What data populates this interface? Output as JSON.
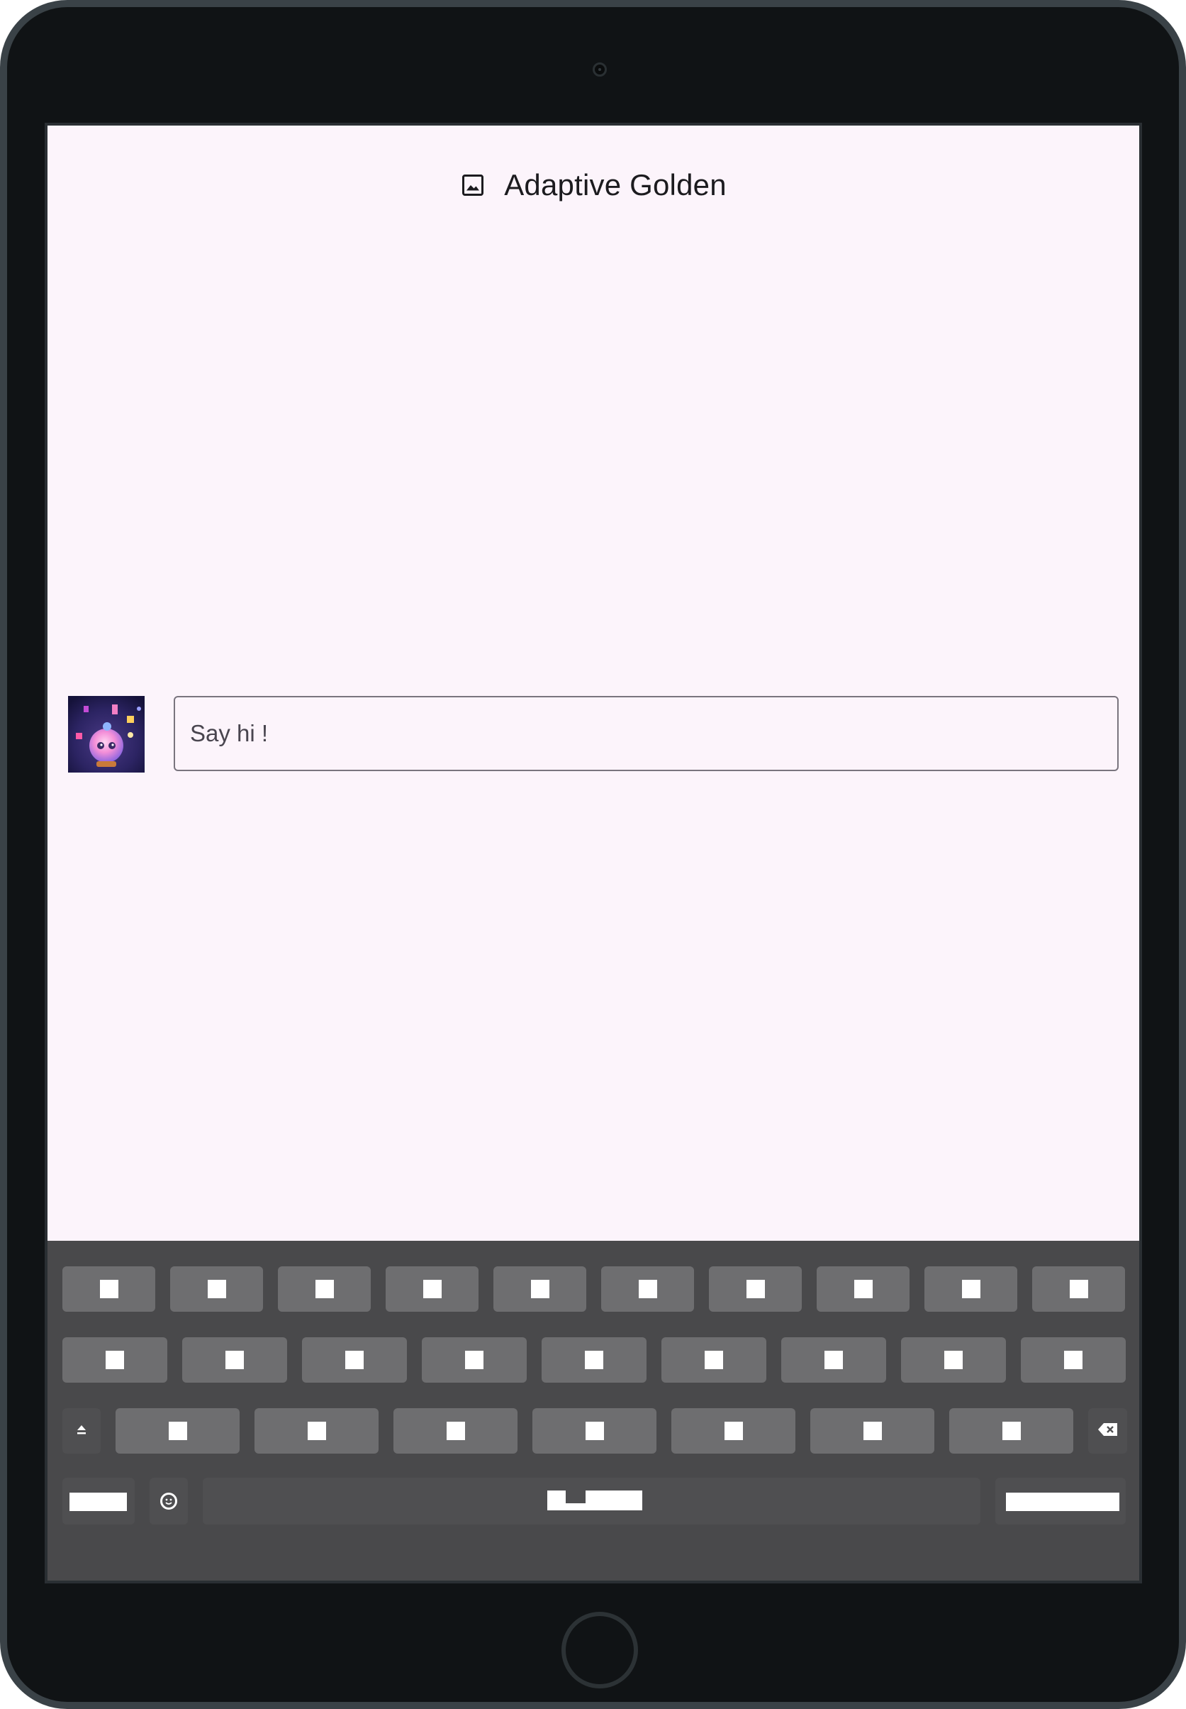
{
  "app_bar": {
    "icon": "image-icon",
    "title": "Adaptive Golden"
  },
  "composer": {
    "avatar": "avatar-image",
    "placeholder": "Say hi !"
  },
  "keyboard": {
    "row1_keys": 10,
    "row2_keys": 9,
    "row3_keys": 7,
    "shift_icon": "shift-icon",
    "backspace_icon": "backspace-icon",
    "emoji_icon": "emoji-icon"
  },
  "colors": {
    "screen_background": "#fcf4fb",
    "keyboard_background": "#49494b",
    "key_background": "#6e6e70",
    "device_frame": "#101315"
  }
}
